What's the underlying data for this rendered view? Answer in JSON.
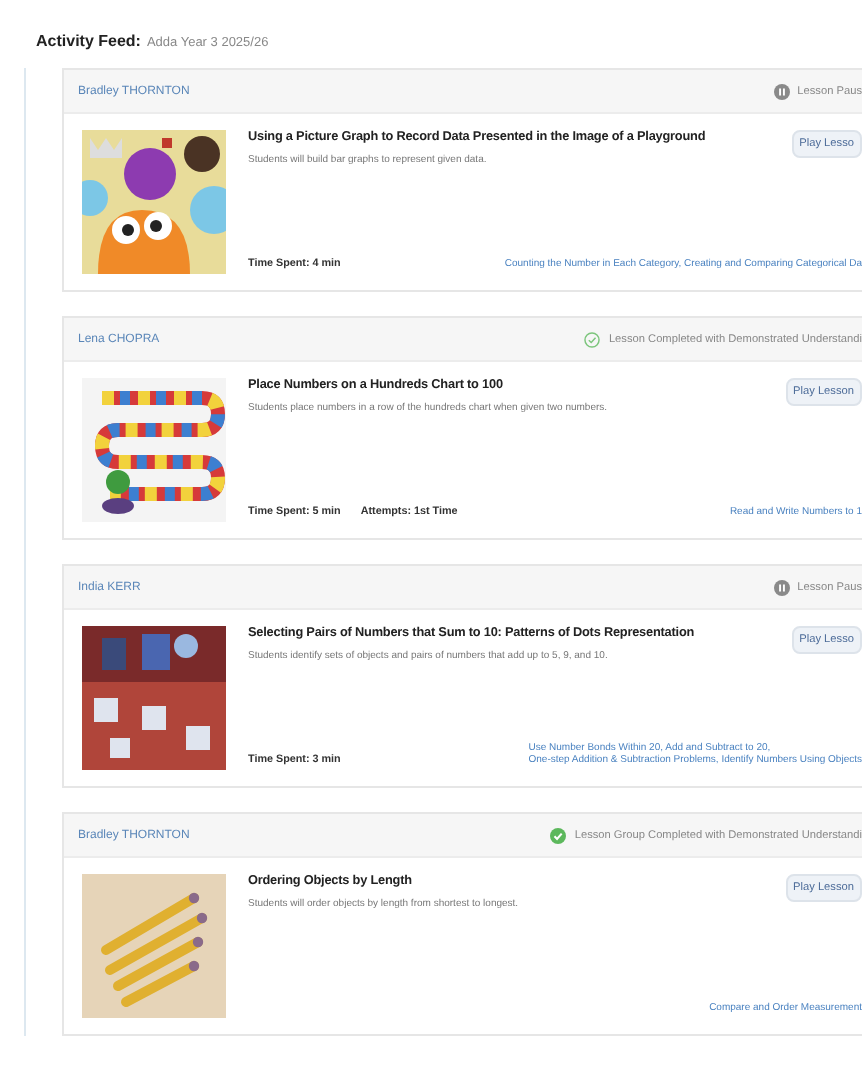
{
  "header": {
    "label": "Activity Feed:",
    "class_name": "Adda Year 3 2025/26"
  },
  "cards": [
    {
      "student": "Bradley THORNTON",
      "status": {
        "kind": "paused",
        "text": "Lesson Paus"
      },
      "kind": "graph",
      "title": "Using a Picture Graph to Record Data Presented in the Image of a Playground",
      "description": "Students will build bar graphs to represent given data.",
      "stats": [
        "Time Spent: 4 min"
      ],
      "skills": [
        "Counting the Number in Each Category, Creating and Comparing Categorical Da"
      ],
      "button": "Play Lesso"
    },
    {
      "student": "Lena CHOPRA",
      "status": {
        "kind": "completed",
        "text": "Lesson Completed with Demonstrated Understandi"
      },
      "kind": "board",
      "title": "Place Numbers on a Hundreds Chart to 100",
      "description": "Students place numbers in a row of the hundreds chart when given two numbers.",
      "stats": [
        "Time Spent: 5 min",
        "Attempts: 1st Time"
      ],
      "skills": [
        "Read and Write Numbers to 1"
      ],
      "button": "Play Lesson"
    },
    {
      "student": "India KERR",
      "status": {
        "kind": "paused",
        "text": "Lesson Paus"
      },
      "kind": "scene",
      "title": "Selecting Pairs of Numbers that Sum to 10: Patterns of Dots Representation",
      "description": "Students identify sets of objects and pairs of numbers that add up to 5, 9, and 10.",
      "stats": [
        "Time Spent: 3 min"
      ],
      "skills": [
        "Use Number Bonds Within 20, Add and Subtract to 20,",
        "One-step Addition & Subtraction Problems, Identify Numbers Using Objects"
      ],
      "button": "Play Lesso"
    },
    {
      "student": "Bradley THORNTON",
      "status": {
        "kind": "group_completed",
        "text": "Lesson Group Completed with Demonstrated Understandi"
      },
      "kind": "pencils",
      "title": "Ordering Objects by Length",
      "description": "Students will order objects by length from shortest to longest.",
      "skills": [
        "Compare and Order Measurement"
      ],
      "button": "Play Lesson"
    }
  ]
}
